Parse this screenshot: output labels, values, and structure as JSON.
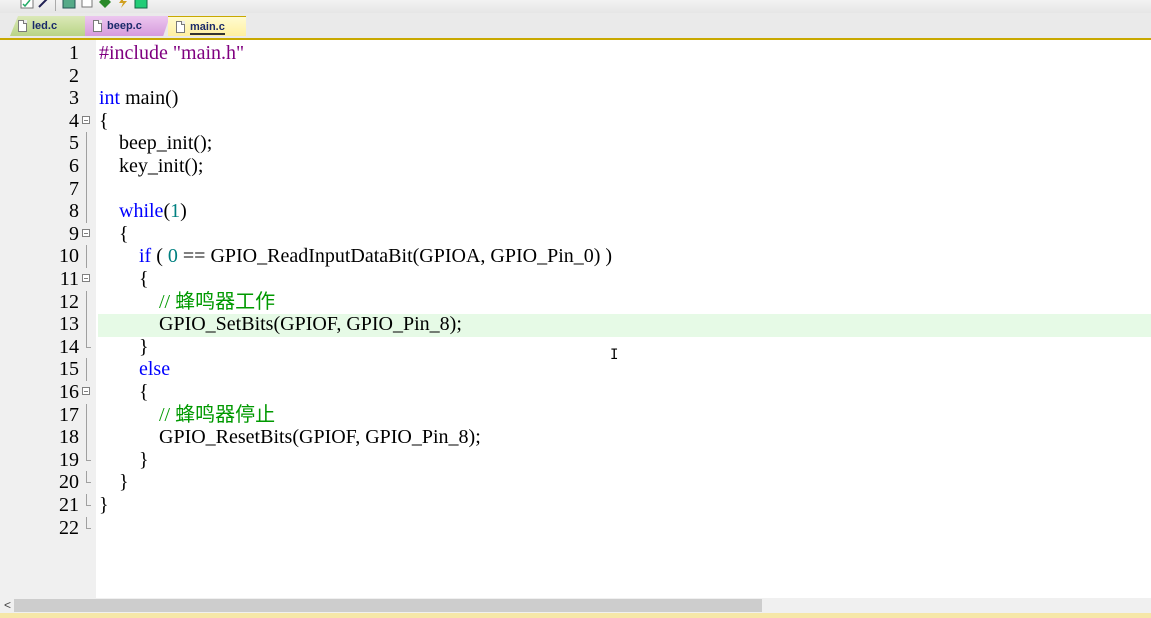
{
  "toolbar": {
    "icons": [
      "checklist-icon",
      "wand-icon",
      "window-icon",
      "copy-icon",
      "diamond-icon",
      "bolt-icon",
      "image-icon"
    ]
  },
  "tabs": [
    {
      "label": "led.c",
      "active": false
    },
    {
      "label": "beep.c",
      "active": false
    },
    {
      "label": "main.c",
      "active": true
    }
  ],
  "colors": {
    "keyword": "#0000ff",
    "preprocessor": "#800080",
    "number": "#008080",
    "comment": "#009900",
    "current_line": "#e6fae6",
    "active_tab_underline": "#c8a800"
  },
  "editor": {
    "current_line": 13,
    "lines": [
      {
        "n": "1",
        "text": "#include \"main.h\""
      },
      {
        "n": "2",
        "text": ""
      },
      {
        "n": "3",
        "text": "int main()"
      },
      {
        "n": "4",
        "text": "{"
      },
      {
        "n": "5",
        "text": "    beep_init();"
      },
      {
        "n": "6",
        "text": "    key_init();"
      },
      {
        "n": "7",
        "text": ""
      },
      {
        "n": "8",
        "text": "    while(1)"
      },
      {
        "n": "9",
        "text": "    {"
      },
      {
        "n": "10",
        "text": "        if ( 0 == GPIO_ReadInputDataBit(GPIOA, GPIO_Pin_0) )"
      },
      {
        "n": "11",
        "text": "        {"
      },
      {
        "n": "12",
        "text": "            // 蜂鸣器工作"
      },
      {
        "n": "13",
        "text": "            GPIO_SetBits(GPIOF, GPIO_Pin_8);"
      },
      {
        "n": "14",
        "text": "        }"
      },
      {
        "n": "15",
        "text": "        else"
      },
      {
        "n": "16",
        "text": "        {"
      },
      {
        "n": "17",
        "text": "            // 蜂鸣器停止"
      },
      {
        "n": "18",
        "text": "            GPIO_ResetBits(GPIOF, GPIO_Pin_8);"
      },
      {
        "n": "19",
        "text": "        }"
      },
      {
        "n": "20",
        "text": "    }"
      },
      {
        "n": "21",
        "text": "}"
      },
      {
        "n": "22",
        "text": ""
      }
    ]
  },
  "scrollbar": {
    "left_arrow": "<",
    "thumb_fraction": 0.66
  }
}
